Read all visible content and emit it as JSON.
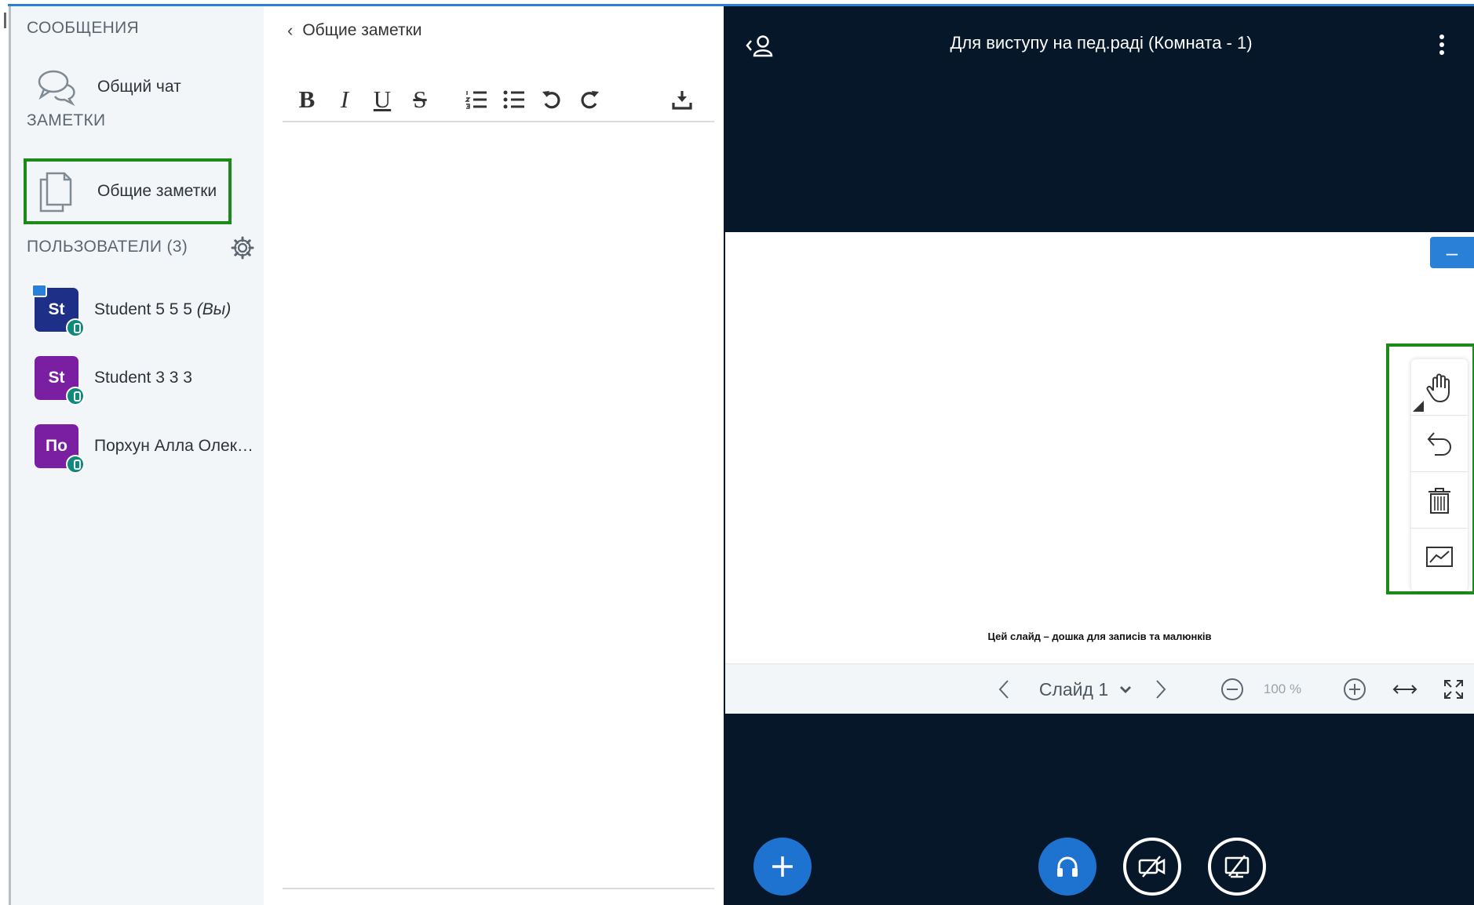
{
  "sidebar": {
    "messages_title": "СООБЩЕНИЯ",
    "chat_label": "Общий чат",
    "notes_title": "ЗАМЕТКИ",
    "notes_label": "Общие заметки",
    "users_title": "ПОЛЬЗОВАТЕЛИ",
    "users_count": "(3)",
    "users": [
      {
        "initials": "St",
        "name": "Student 5 5 5",
        "you": "(Вы)",
        "color": "#1d2f86"
      },
      {
        "initials": "St",
        "name": "Student 3 3 3",
        "color": "#7b1fa2"
      },
      {
        "initials": "По",
        "name": "Порхун Алла Олек…",
        "color": "#7b1fa2"
      }
    ]
  },
  "notes": {
    "back_label": "Общие заметки",
    "toolbar": {
      "bold": "B",
      "italic": "I",
      "underline": "U",
      "strike": "S"
    }
  },
  "stage": {
    "title": "Для виступу на пед.раді (Комната - 1)",
    "slide_caption": "Цей слайд – дошка для записів та малюнків",
    "slide_selector": "Слайд 1",
    "zoom": "100 %"
  },
  "colors": {
    "accent": "#2a7fd6",
    "highlight": "#1b8a1b",
    "stage_bg": "#06172a"
  }
}
